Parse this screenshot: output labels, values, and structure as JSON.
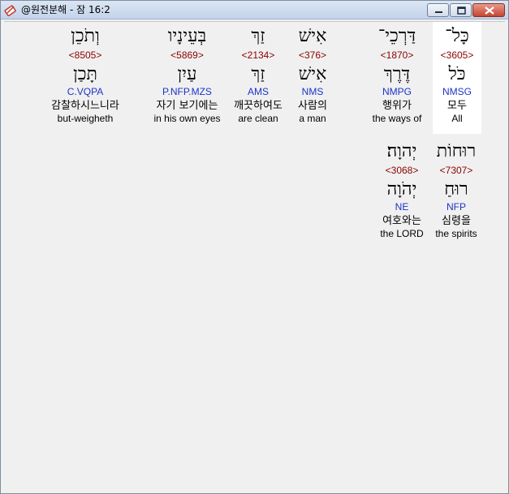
{
  "window": {
    "title": "@원전분해 - 잠 16:2"
  },
  "words": [
    {
      "hebrew": "כָּל־",
      "strong": "<3605>",
      "lemma": "כֹּל",
      "morph": "NMSG",
      "korean": "모두",
      "english": "All",
      "selected": true
    },
    {
      "hebrew": "דַּרְכֵי־",
      "strong": "<1870>",
      "lemma": "דֶּרֶךְ",
      "morph": "NMPG",
      "korean": "행위가",
      "english": "the ways of",
      "selected": false
    },
    {
      "hebrew": "אִישׁ",
      "strong": "<376>",
      "lemma": "אִישׁ",
      "morph": "NMS",
      "korean": "사람의",
      "english": "a man",
      "selected": false
    },
    {
      "hebrew": "זַךְ",
      "strong": "<2134>",
      "lemma": "זַךְ",
      "morph": "AMS",
      "korean": "깨끗하여도",
      "english": "are clean",
      "selected": false
    },
    {
      "hebrew": "בְּעֵינָיו",
      "strong": "<5869>",
      "lemma": "עַיִן",
      "morph": "P.NFP.MZS",
      "korean": "자기 보기에는",
      "english": "in his own eyes",
      "selected": false
    },
    {
      "hebrew": "וְתֹכֵן",
      "strong": "<8505>",
      "lemma": "תָּכַן",
      "morph": "C.VQPA",
      "korean": "감찰하시느니라",
      "english": "but-weigheth",
      "selected": false
    },
    {
      "hebrew": "רוּחוֹת",
      "strong": "<7307>",
      "lemma": "רוּחַ",
      "morph": "NFP",
      "korean": "심령을",
      "english": "the spirits",
      "selected": false
    },
    {
      "hebrew": "יְהוָה׃",
      "strong": "<3068>",
      "lemma": "יְהֹוָה",
      "morph": "NE",
      "korean": "여호와는",
      "english": "the LORD",
      "selected": false
    }
  ]
}
